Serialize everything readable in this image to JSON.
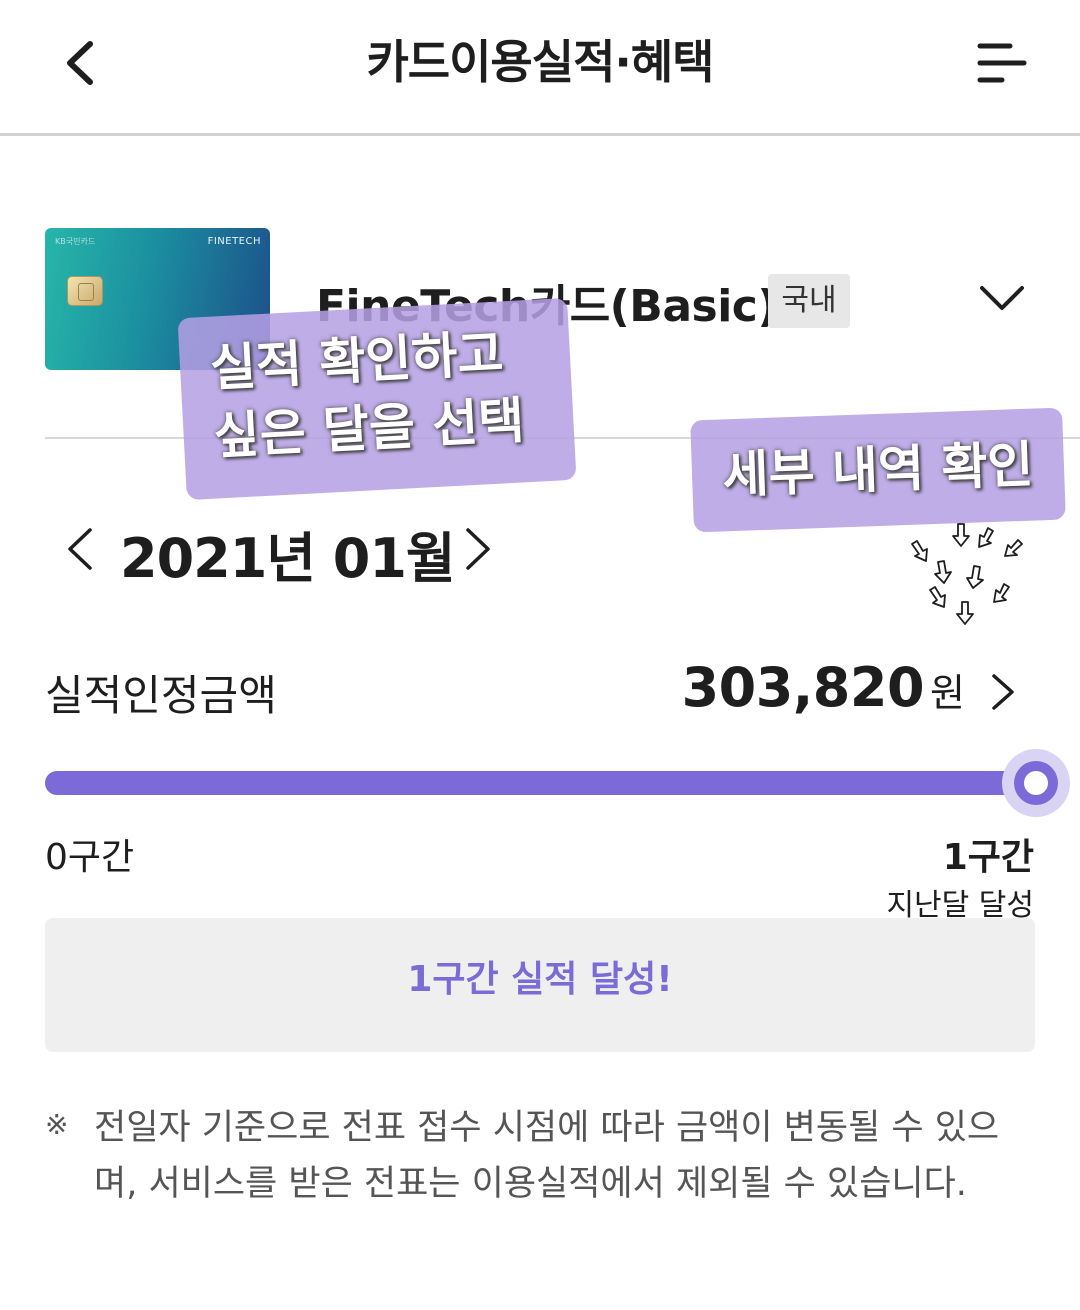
{
  "header": {
    "title": "카드이용실적·혜택",
    "back_icon": "chevron-left-icon",
    "menu_icon": "menu-icon"
  },
  "card": {
    "brand": "FINETECH",
    "bank": "KB국민카드",
    "name": "FineTech카드(Basic)",
    "badge": "국내"
  },
  "month": {
    "label": "2021년 01월"
  },
  "performance": {
    "label": "실적인정금액",
    "amount": "303,820",
    "unit": "원",
    "progress_fraction": 1.0,
    "tier_start": "0구간",
    "tier_end": "1구간",
    "tier_end_sub": "지난달 달성",
    "achievement": "1구간 실적 달성!"
  },
  "footnote": {
    "mark": "※",
    "text": "전일자 기준으로 전표 접수 시점에 따라 금액이 변동될 수 있으며, 서비스를 받은 전표는 이용실적에서 제외될 수 있습니다."
  },
  "annotations": {
    "select_month": "실적 확인하고 싶은 달을 선택",
    "select_month_line1": "실적 확인하고",
    "select_month_line2": "싶은 달을 선택",
    "detail": "세부 내역 확인"
  },
  "colors": {
    "accent": "#7b6ad8",
    "achieve_text": "#7a6bd6",
    "sticker": "#b4a0e4"
  }
}
